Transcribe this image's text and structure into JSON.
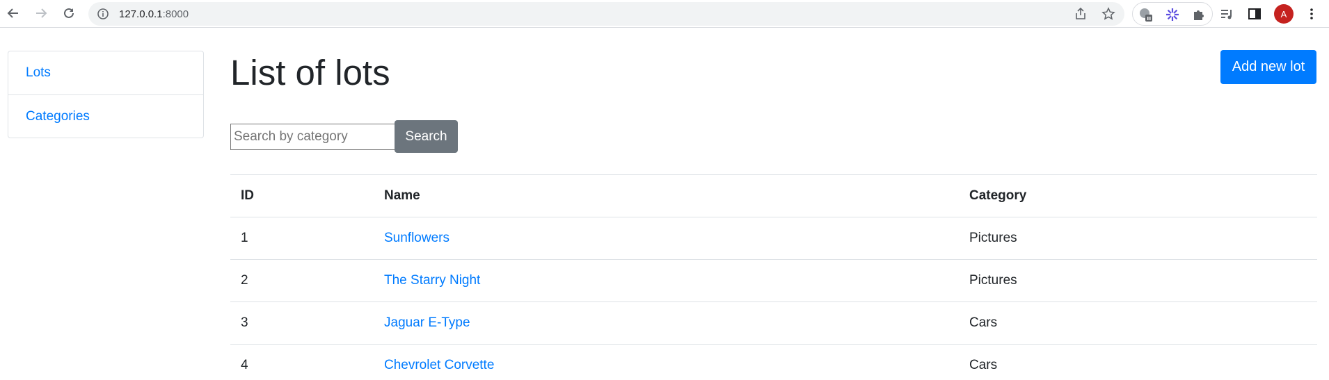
{
  "browser": {
    "url_host": "127.0.0.1",
    "url_port": ":8000",
    "avatar_letter": "A"
  },
  "sidebar": {
    "items": [
      {
        "label": "Lots"
      },
      {
        "label": "Categories"
      }
    ]
  },
  "main": {
    "title": "List of lots",
    "add_button_label": "Add new lot",
    "search": {
      "placeholder": "Search by category",
      "value": "",
      "button_label": "Search"
    },
    "table": {
      "columns": [
        "ID",
        "Name",
        "Category"
      ],
      "rows": [
        {
          "id": "1",
          "name": "Sunflowers",
          "category": "Pictures"
        },
        {
          "id": "2",
          "name": "The Starry Night",
          "category": "Pictures"
        },
        {
          "id": "3",
          "name": "Jaguar E-Type",
          "category": "Cars"
        },
        {
          "id": "4",
          "name": "Chevrolet Corvette",
          "category": "Cars"
        }
      ]
    }
  },
  "colors": {
    "primary": "#007bff",
    "secondary": "#6c757d",
    "text": "#212529",
    "avatar": "#c5221f"
  }
}
